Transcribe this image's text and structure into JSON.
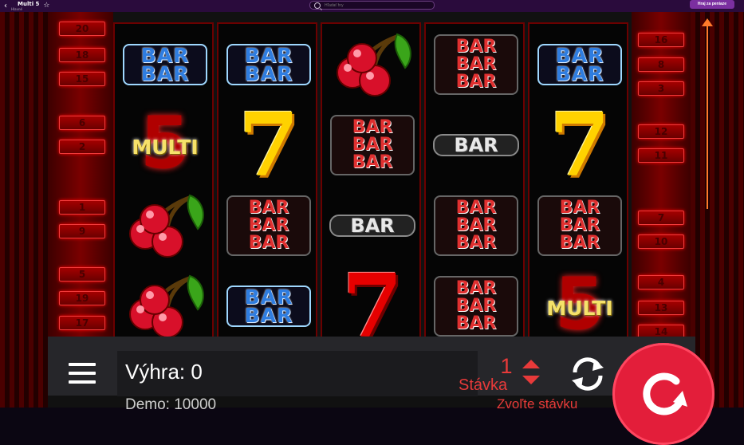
{
  "topbar": {
    "back_icon": "chevron-left-icon",
    "title": "Multi 5",
    "subtitle": "Hlavné",
    "favorite_icon": "star-outline-icon",
    "search_placeholder": "Hľadať hry",
    "play_for_money": "Hraj za peniaze"
  },
  "paylines": {
    "left": [
      "20",
      "18",
      "15",
      "6",
      "2",
      "1",
      "9",
      "5",
      "19",
      "17"
    ],
    "right": [
      "16",
      "8",
      "3",
      "12",
      "11",
      "7",
      "10",
      "4",
      "13",
      "14"
    ]
  },
  "reels": [
    [
      "bar-double-blue",
      "multi-5",
      "cherries",
      "cherries"
    ],
    [
      "bar-double-blue",
      "seven-yellow",
      "bar-triple-red",
      "bar-double-blue"
    ],
    [
      "cherries",
      "bar-triple-red",
      "bar-single-white",
      "seven-red"
    ],
    [
      "bar-triple-red",
      "bar-single-white",
      "bar-triple-red",
      "bar-triple-red"
    ],
    [
      "bar-double-blue",
      "seven-yellow",
      "bar-triple-red",
      "multi-5"
    ]
  ],
  "symbol_text": {
    "bar": "BAR",
    "multi": "MULTI",
    "five": "5",
    "seven": "7"
  },
  "controls": {
    "menu_icon": "hamburger-menu-icon",
    "win_label": "Výhra: 0",
    "demo_label": "Demo: 10000",
    "bet_value": "1",
    "bet_label": "Stávka",
    "bet_hint": "Zvoľte stávku",
    "bet_up_icon": "triangle-up-icon",
    "bet_down_icon": "triangle-down-icon",
    "autoplay_icon": "refresh-icon",
    "spin_icon": "spin-arrow-icon"
  },
  "colors": {
    "topbar": "#2a0b3c",
    "accent_purple": "#7b2fa0",
    "panel_red": "#7a0000",
    "spin_red": "#e31e3a",
    "bet_red": "#e83a3a",
    "arrow_orange": "#ff7a2a"
  }
}
